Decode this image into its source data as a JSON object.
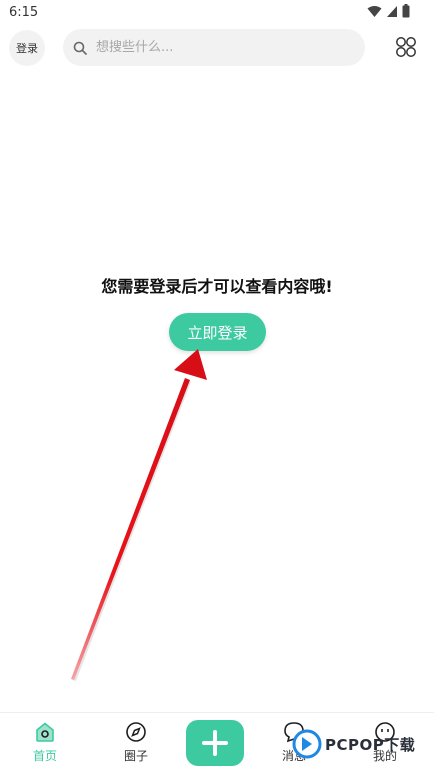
{
  "status_bar": {
    "time": "6:15"
  },
  "header": {
    "login_label": "登录",
    "search_placeholder": "想搜些什么..."
  },
  "main": {
    "prompt_text": "您需要登录后才可以查看内容哦!",
    "login_button_label": "立即登录"
  },
  "tab_bar": {
    "items": [
      {
        "label": "首页",
        "icon": "home-icon",
        "active": true
      },
      {
        "label": "圈子",
        "icon": "compass-icon",
        "active": false
      },
      {
        "label": "",
        "icon": "plus-icon",
        "active": false
      },
      {
        "label": "消息",
        "icon": "chat-icon",
        "active": false
      },
      {
        "label": "我的",
        "icon": "face-icon",
        "active": false
      }
    ]
  },
  "watermark": {
    "text": "PCPOP下载"
  },
  "colors": {
    "accent": "#3ecaa0",
    "arrow": "#e8131b"
  }
}
